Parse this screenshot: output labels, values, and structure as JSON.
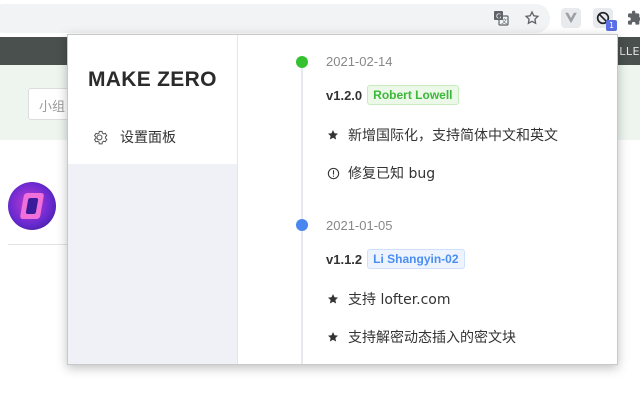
{
  "page_behind": {
    "header_text": "ILLE",
    "search_placeholder": "小组"
  },
  "toolbar": {
    "icons": [
      "translate-icon",
      "star-icon",
      "vue-devtools-icon",
      "make-zero-icon",
      "extensions-icon"
    ],
    "ext_badge": "1"
  },
  "popup": {
    "brand": "MAKE ZERO",
    "sidebar": {
      "items": [
        {
          "label": "设置面板",
          "icon": "gear-icon"
        }
      ]
    },
    "changelog": [
      {
        "date": "2021-02-14",
        "version": "v1.2.0",
        "author": "Robert Lowell",
        "author_color": "#3cb83a",
        "dot_color": "#34c230",
        "items": [
          {
            "type": "feature",
            "icon": "star-icon",
            "text": "新增国际化，支持简体中文和英文"
          },
          {
            "type": "fix",
            "icon": "info-circle-icon",
            "text": "修复已知 bug"
          }
        ]
      },
      {
        "date": "2021-01-05",
        "version": "v1.1.2",
        "author": "Li Shangyin-02",
        "author_color": "#4a8ef0",
        "dot_color": "#4a86f0",
        "items": [
          {
            "type": "feature",
            "icon": "star-icon",
            "text": "支持 lofter.com"
          },
          {
            "type": "feature",
            "icon": "star-icon",
            "text": "支持解密动态插入的密文块"
          }
        ]
      }
    ]
  }
}
